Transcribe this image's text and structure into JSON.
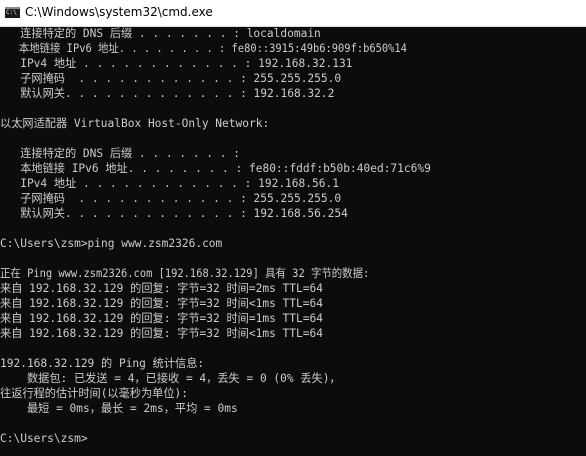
{
  "window": {
    "title": "C:\\Windows\\system32\\cmd.exe",
    "icon": "cmd-console-icon",
    "icon_text": "C:\\"
  },
  "console": {
    "background": "#0c0c0c",
    "foreground": "#cccccc",
    "lines": [
      "   连接特定的 DNS 后缀 . . . . . . . : localdomain",
      "   本地链接 IPv6 地址. . . . . . . . : fe80::3915:49b6:909f:b650%14",
      "   IPv4 地址 . . . . . . . . . . . . : 192.168.32.131",
      "   子网掩码  . . . . . . . . . . . . : 255.255.255.0",
      "   默认网关. . . . . . . . . . . . . : 192.168.32.2",
      "",
      "以太网适配器 VirtualBox Host-Only Network:",
      "",
      "   连接特定的 DNS 后缀 . . . . . . . :",
      "   本地链接 IPv6 地址. . . . . . . . : fe80::fddf:b50b:40ed:71c6%9",
      "   IPv4 地址 . . . . . . . . . . . . : 192.168.56.1",
      "   子网掩码  . . . . . . . . . . . . : 255.255.255.0",
      "   默认网关. . . . . . . . . . . . . : 192.168.56.254",
      "",
      "C:\\Users\\zsm>ping www.zsm2326.com",
      "",
      "正在 Ping www.zsm2326.com [192.168.32.129] 具有 32 字节的数据:",
      "来自 192.168.32.129 的回复: 字节=32 时间=2ms TTL=64",
      "来自 192.168.32.129 的回复: 字节=32 时间<1ms TTL=64",
      "来自 192.168.32.129 的回复: 字节=32 时间=1ms TTL=64",
      "来自 192.168.32.129 的回复: 字节=32 时间<1ms TTL=64",
      "",
      "192.168.32.129 的 Ping 统计信息:",
      "    数据包: 已发送 = 4，已接收 = 4，丢失 = 0 (0% 丢失)，",
      "往返行程的估计时间(以毫秒为单位):",
      "    最短 = 0ms，最长 = 2ms，平均 = 0ms",
      "",
      "C:\\Users\\zsm>"
    ]
  }
}
